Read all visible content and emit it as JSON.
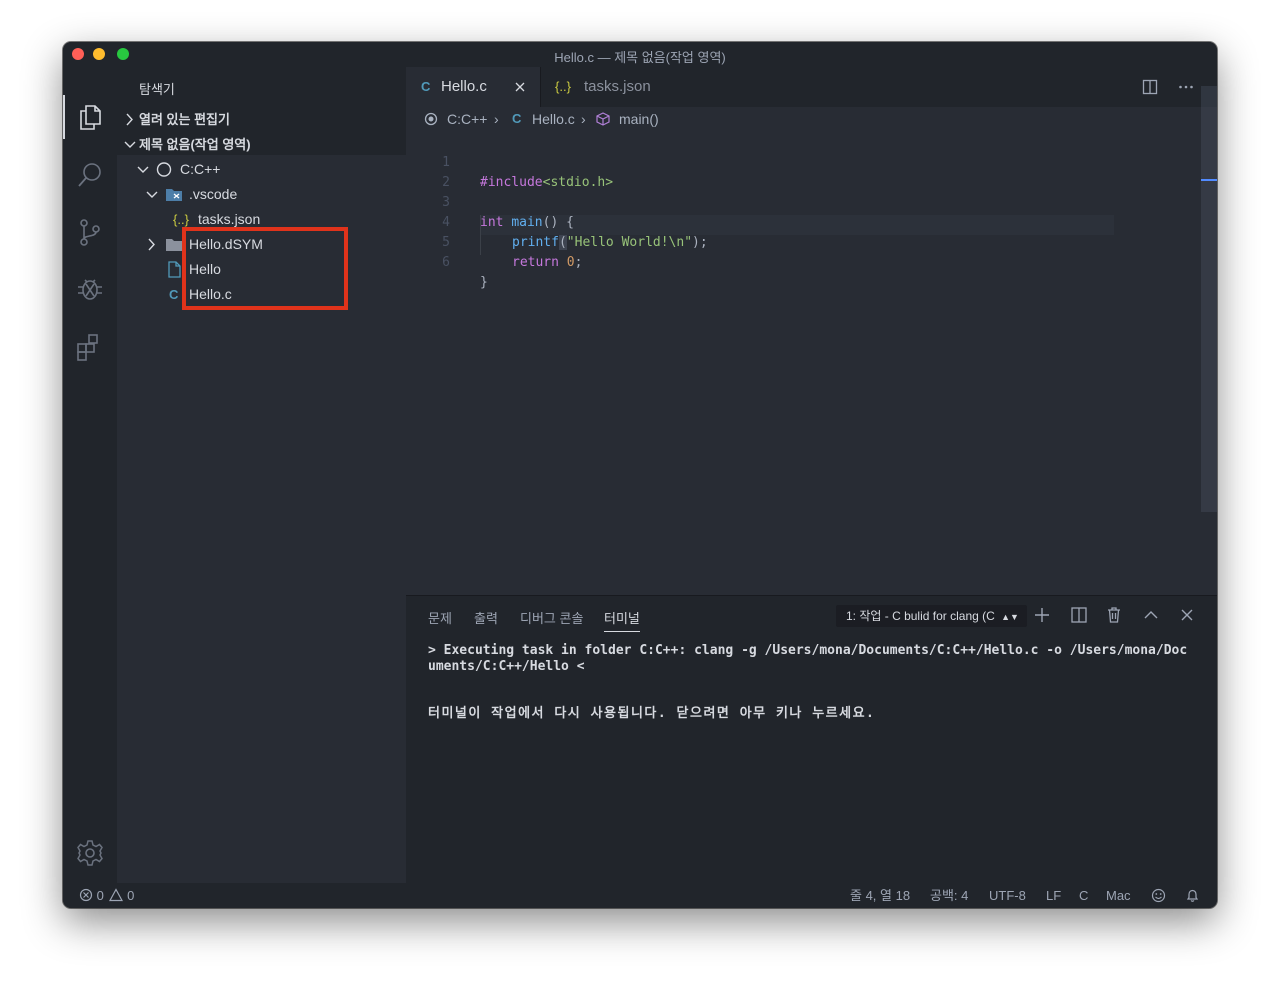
{
  "window": {
    "title": "Hello.c — 제목 없음(작업 영역)"
  },
  "activity_bar": {
    "items": [
      "files-icon",
      "search-icon",
      "source-control-icon",
      "debug-icon",
      "extensions-icon"
    ],
    "bottom": "gear-icon"
  },
  "sidebar": {
    "header": "탐색기",
    "open_editors_label": "열려 있는 편집기",
    "workspace_label": "제목 없음(작업 영역)",
    "tree": {
      "root": "C:C++",
      "vscode": ".vscode",
      "tasks": "tasks.json",
      "dsym": "Hello.dSYM",
      "hello": "Hello",
      "hello_c": "Hello.c"
    }
  },
  "tabs": [
    {
      "icon": "C",
      "label": "Hello.c",
      "active": true
    },
    {
      "icon": "{..}",
      "label": "tasks.json",
      "active": false
    }
  ],
  "breadcrumb": {
    "folder": "C:C++",
    "file_icon": "C",
    "file": "Hello.c",
    "symbol": "main()"
  },
  "editor": {
    "line_numbers": [
      "1",
      "2",
      "3",
      "4",
      "5",
      "6"
    ],
    "lines": {
      "l1_directive": "#include",
      "l1_header": "<stdio.h>",
      "l3_type": "int",
      "l3_fn": "main",
      "l3_rest": "() {",
      "l4_fn": "printf",
      "l4_open": "(",
      "l4_str": "\"Hello World!\\n\"",
      "l4_close": ");",
      "l5_kw": "return",
      "l5_num": "0",
      "l5_semi": ";",
      "l6": "}"
    }
  },
  "panel": {
    "tabs": [
      "문제",
      "출력",
      "디버그 콘솔",
      "터미널"
    ],
    "active_tab": "터미널",
    "terminal_select": "1: 작업 - C bulid for clang (C",
    "terminal_lines": {
      "line1": "> Executing task in folder C:C++: clang -g /Users/mona/Documents/C:C++/Hello.c -o /Users/mona/Doc",
      "line2": "uments/C:C++/Hello <",
      "line3": "터미널이 작업에서 다시 사용됩니다. 닫으려면 아무 키나 누르세요."
    }
  },
  "status_bar": {
    "errors": "0",
    "warnings": "0",
    "position": "줄 4, 열 18",
    "spaces": "공백: 4",
    "encoding": "UTF-8",
    "eol": "LF",
    "language": "C",
    "platform": "Mac"
  },
  "colors": {
    "highlight_box": "#e0331b",
    "c_icon": "#519aba",
    "json_icon": "#cbcb41",
    "folder_icon": "#4d7ea8"
  }
}
